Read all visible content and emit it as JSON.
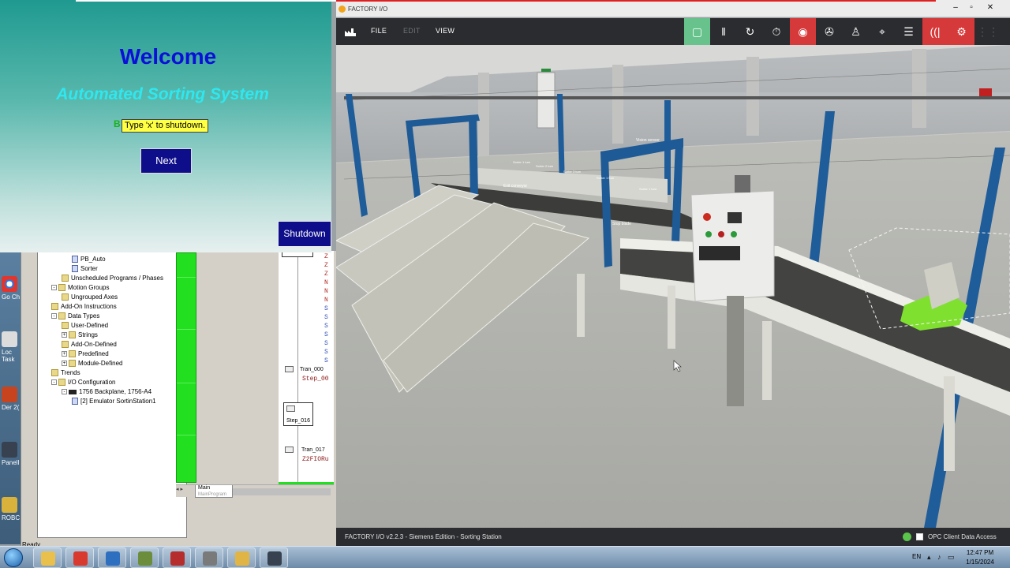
{
  "hmi": {
    "welcome": "Welcome",
    "subtitle": "Automated Sorting System",
    "hidden_text": "B",
    "tooltip": "Type 'x' to shutdown.",
    "next_label": "Next",
    "shutdown_label": "Shutdown",
    "colors": {
      "title": "#0a10d8",
      "subtitle": "#2ee8f0",
      "button": "#0e0e8a"
    }
  },
  "desktop": {
    "icons": [
      {
        "label": "Go Ch",
        "icon": "chrome-icon"
      },
      {
        "label": "Loc Task",
        "icon": "task-icon"
      },
      {
        "label": "Der 2(",
        "icon": "der-icon"
      },
      {
        "label": "PanelI",
        "icon": "panel-icon"
      },
      {
        "label": "ROBC",
        "icon": "robo-icon"
      }
    ]
  },
  "rslogix": {
    "tree": [
      {
        "label": "PB_Auto",
        "indent": 3,
        "kind": "doc"
      },
      {
        "label": "Sorter",
        "indent": 3,
        "kind": "doc"
      },
      {
        "label": "Unscheduled Programs / Phases",
        "indent": 2,
        "kind": "folder"
      },
      {
        "label": "Motion Groups",
        "indent": 1,
        "kind": "folder",
        "pm": "-"
      },
      {
        "label": "Ungrouped Axes",
        "indent": 2,
        "kind": "folder"
      },
      {
        "label": "Add-On Instructions",
        "indent": 1,
        "kind": "folder"
      },
      {
        "label": "Data Types",
        "indent": 1,
        "kind": "folder",
        "pm": "-"
      },
      {
        "label": "User-Defined",
        "indent": 2,
        "kind": "folder"
      },
      {
        "label": "Strings",
        "indent": 2,
        "kind": "folder",
        "pm": "+"
      },
      {
        "label": "Add-On-Defined",
        "indent": 2,
        "kind": "folder"
      },
      {
        "label": "Predefined",
        "indent": 2,
        "kind": "folder",
        "pm": "+"
      },
      {
        "label": "Module-Defined",
        "indent": 2,
        "kind": "folder",
        "pm": "+"
      },
      {
        "label": "Trends",
        "indent": 1,
        "kind": "folder"
      },
      {
        "label": "I/O Configuration",
        "indent": 1,
        "kind": "folder",
        "pm": "-"
      },
      {
        "label": "1756 Backplane, 1756-A4",
        "indent": 2,
        "kind": "device",
        "pm": "-"
      },
      {
        "label": "[2] Emulator SortinStation1",
        "indent": 3,
        "kind": "doc"
      }
    ],
    "sfc": {
      "tran_000": "Tran_000",
      "step_00": "Step_00",
      "step_016": "Step_016",
      "tran_017": "Tran_017",
      "z2fio": "Z2FIORu",
      "right_codes": [
        "Z",
        "Z",
        "Z",
        "N",
        "N",
        "N",
        "S",
        "S",
        "S",
        "S",
        "S",
        "S",
        "S"
      ]
    },
    "tab": {
      "main": "Main",
      "sub": "MainProgram"
    },
    "status": "Ready"
  },
  "factoryio": {
    "window_title": "FACTORY I/O",
    "menu": {
      "file": "FILE",
      "edit": "EDIT",
      "view": "VIEW"
    },
    "toolbar": [
      {
        "name": "run-icon",
        "glyph": "▢",
        "style": "green"
      },
      {
        "name": "pause-icon",
        "glyph": "‖",
        "style": ""
      },
      {
        "name": "reset-icon",
        "glyph": "↻",
        "style": ""
      },
      {
        "name": "timer-icon",
        "glyph": "⏱",
        "style": ""
      },
      {
        "name": "camera-orbit-icon",
        "glyph": "◉",
        "style": "red"
      },
      {
        "name": "fan-icon",
        "glyph": "✇",
        "style": ""
      },
      {
        "name": "first-person-icon",
        "glyph": "♙",
        "style": ""
      },
      {
        "name": "target-icon",
        "glyph": "⌖",
        "style": ""
      },
      {
        "name": "list-icon",
        "glyph": "☰",
        "style": ""
      },
      {
        "name": "sensor-signal-icon",
        "glyph": "((|",
        "style": "red"
      },
      {
        "name": "drivers-icon",
        "glyph": "⚙",
        "style": "red"
      },
      {
        "name": "grid-icon",
        "glyph": "⋮⋮",
        "style": "dim"
      }
    ],
    "scene_labels": {
      "vision_sensor": "Vision sensor",
      "exit_conveyor": "Exit conveyor",
      "stop_blade": "Stop blade",
      "sorter_labels": [
        "Sorter 1 turn",
        "Sorter 2 turn",
        "Sorter 3 turn",
        "Sorter 1 turn",
        "Sorter 1 turn"
      ]
    },
    "status_text": "FACTORY I/O v2.2.3 - Siemens Edition - Sorting Station",
    "opc_text": "OPC Client Data Access"
  },
  "taskbar": {
    "apps": [
      "explorer-icon",
      "chrome-icon",
      "search-app-icon",
      "tools-icon",
      "pdf-icon",
      "network-icon",
      "folder-icon",
      "factoryio-icon"
    ],
    "lang": "EN",
    "time": "12:47 PM",
    "date": "1/15/2024"
  }
}
